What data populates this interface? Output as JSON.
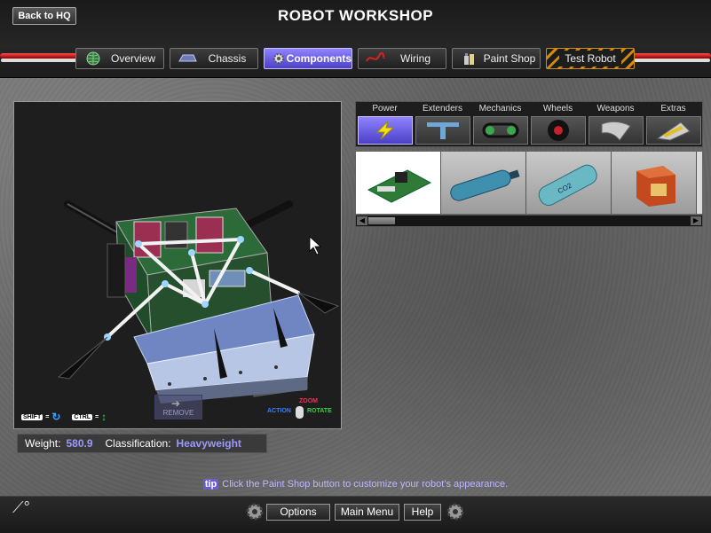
{
  "header": {
    "back_label": "Back to HQ",
    "title": "ROBOT WORKSHOP"
  },
  "tabs": [
    {
      "label": "Overview",
      "icon": "globe-icon"
    },
    {
      "label": "Chassis",
      "icon": "chassis-icon"
    },
    {
      "label": "Components",
      "icon": "gear-icon",
      "active": true
    },
    {
      "label": "Wiring",
      "icon": "wire-icon"
    },
    {
      "label": "Paint Shop",
      "icon": "paint-can-icon"
    },
    {
      "label": "Test Robot",
      "icon": ""
    }
  ],
  "viewport": {
    "remove_label": "REMOVE",
    "hint_shift": "SHIFT",
    "hint_ctrl": "CTRL",
    "hint_zoom": "ZOOM",
    "hint_action": "ACTION",
    "hint_rotate": "ROTATE"
  },
  "stats": {
    "weight_label": "Weight:",
    "weight_value": "580.9",
    "class_label": "Classification:",
    "class_value": "Heavyweight"
  },
  "categories": [
    {
      "label": "Power",
      "icon": "lightning-icon",
      "active": true
    },
    {
      "label": "Extenders",
      "icon": "t-bar-icon"
    },
    {
      "label": "Mechanics",
      "icon": "chain-icon"
    },
    {
      "label": "Wheels",
      "icon": "wheel-icon"
    },
    {
      "label": "Weapons",
      "icon": "blade-icon"
    },
    {
      "label": "Extras",
      "icon": "wedge-icon"
    }
  ],
  "items": [
    "circuit-board-icon",
    "blue-tank-icon",
    "co2-tank-icon",
    "battery-box-icon"
  ],
  "tip": {
    "badge": "tip",
    "text": "Click the Paint Shop button to customize your robot's appearance."
  },
  "footer": {
    "options": "Options",
    "main_menu": "Main Menu",
    "help": "Help"
  },
  "colors": {
    "accent": "#6a5ed8",
    "value_text": "#9a9aff",
    "test_stripe": "#d08b10"
  }
}
